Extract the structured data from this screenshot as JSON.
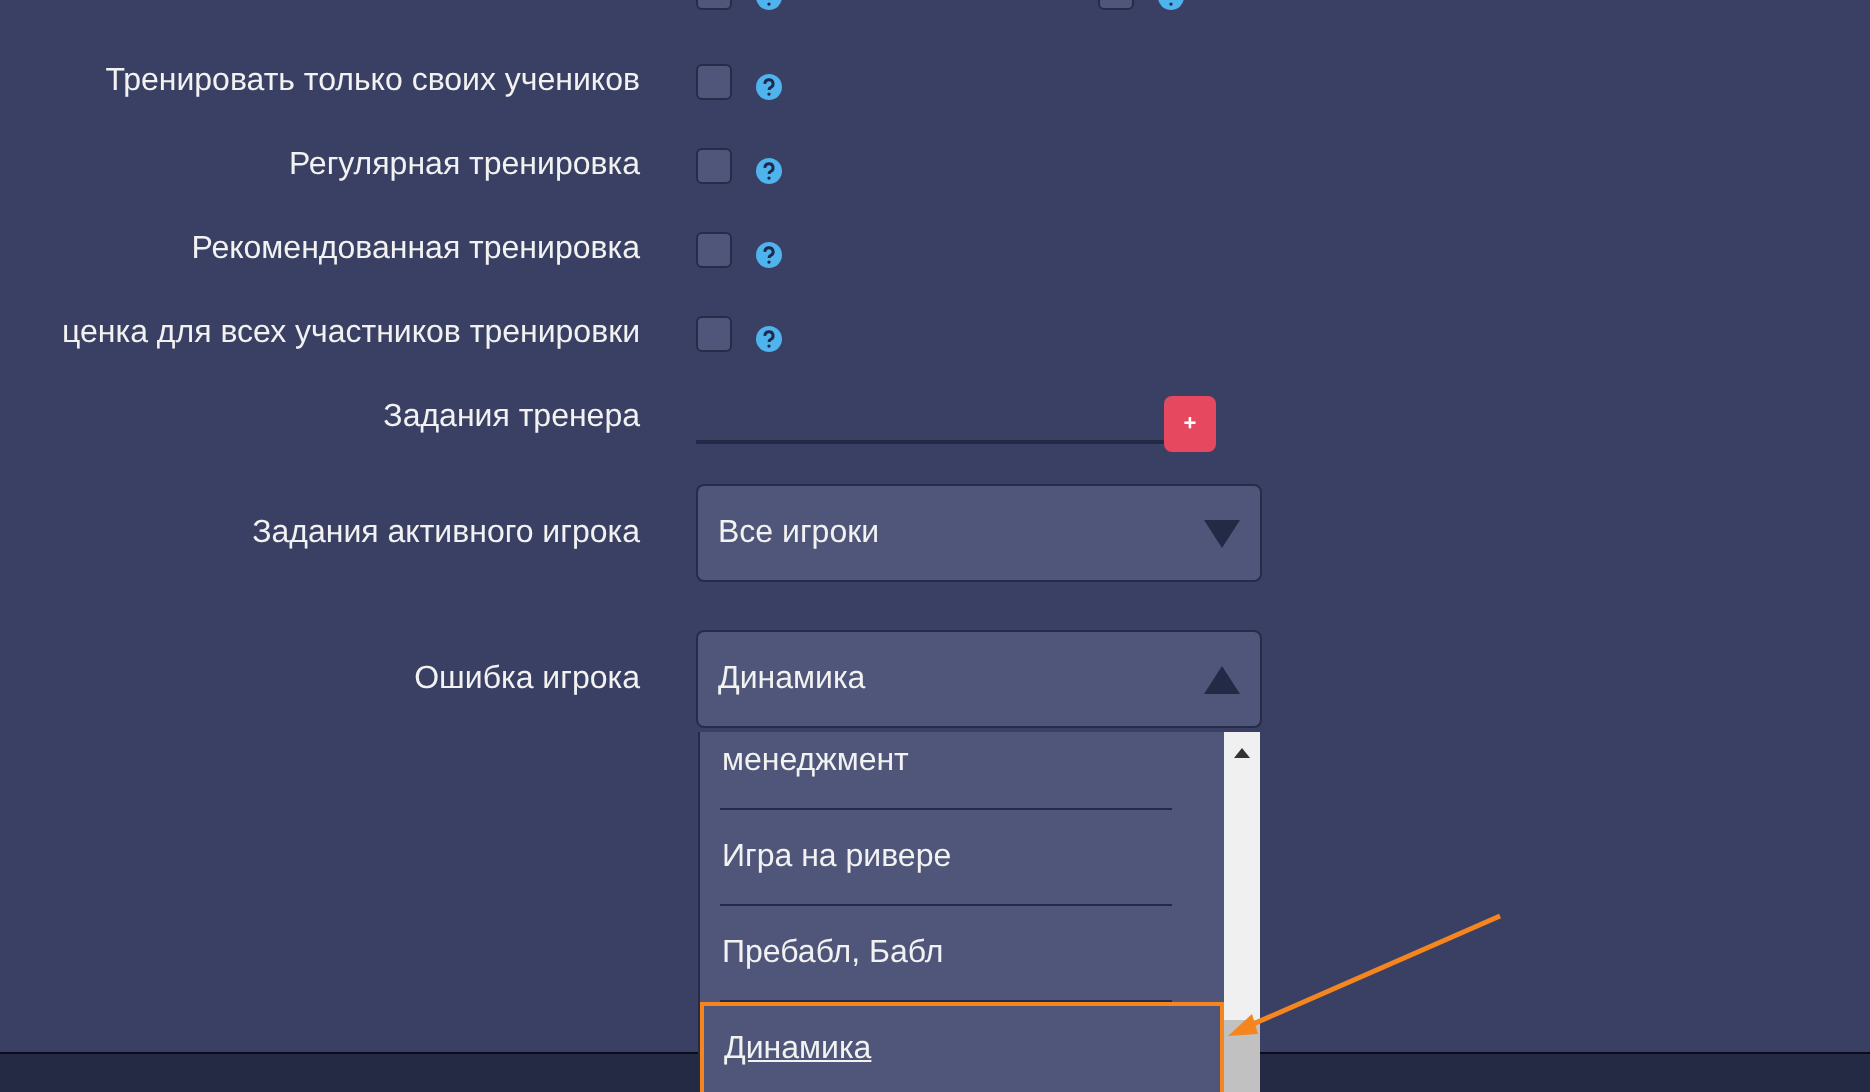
{
  "partial_row": [
    {
      "checked": false
    },
    {
      "checked": false
    }
  ],
  "settings": [
    {
      "kind": "checkbox",
      "label": "Тренировать только своих учеников",
      "checked": false
    },
    {
      "kind": "checkbox",
      "label": "Регулярная тренировка",
      "checked": false
    },
    {
      "kind": "checkbox",
      "label": "Рекомендованная тренировка",
      "checked": false
    },
    {
      "kind": "checkbox",
      "label": "ценка для всех участников тренировки",
      "checked": false
    },
    {
      "kind": "tasks",
      "label": "Задания тренера",
      "add_button": "+"
    },
    {
      "kind": "select",
      "label": "Задания активного игрока",
      "value": "Все игроки",
      "expanded": false
    },
    {
      "kind": "select",
      "label": "Ошибка игрока",
      "value": "Динамика",
      "expanded": true,
      "options": [
        {
          "label": "менеджмент",
          "selected": false
        },
        {
          "label": "Игра на ривере",
          "selected": false
        },
        {
          "label": "Пребабл, Бабл",
          "selected": false
        },
        {
          "label": "Динамика",
          "selected": true
        }
      ]
    }
  ]
}
